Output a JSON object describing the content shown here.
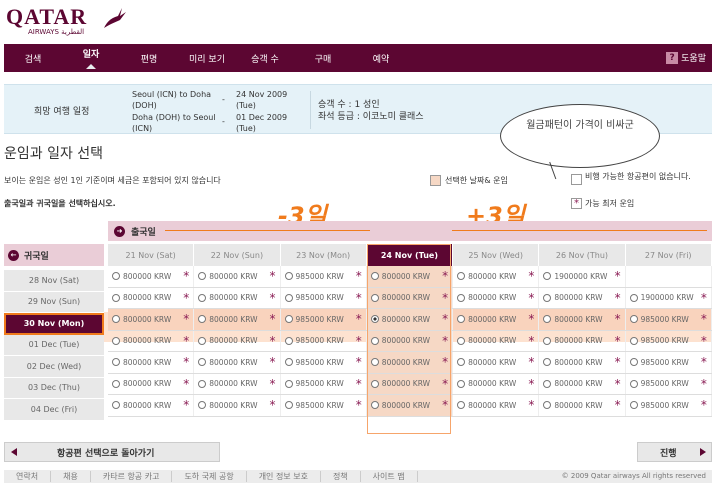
{
  "brand": {
    "name": "QATAR",
    "sub": "AIRWAYS القطرية"
  },
  "nav": {
    "items": [
      "검색",
      "일자",
      "편명",
      "미리 보기",
      "승객 수",
      "구매",
      "예약"
    ],
    "help": "도움말"
  },
  "summary": {
    "title": "희망 여행 일정",
    "out_route": "Seoul (ICN) to Doha (DOH)",
    "out_date": "24 Nov 2009 (Tue)",
    "ret_route": "Doha (DOH) to Seoul (ICN)",
    "ret_date": "01 Dec 2009 (Tue)",
    "pax": "승객 수 : 1 성인",
    "cabin": "좌석 등급 : 이코노미 클래스"
  },
  "section_title": "운임과 일자 선택",
  "note": "보이는 운임은 성인 1인 기준이며 세금은 포함되어 있지 않습니다",
  "instruction": "출국일과 귀국일을 선택하십시오.",
  "legend": {
    "selected": "선택한 날짜& 운임",
    "unavailable": "비행 가능한 항공편이 없습니다.",
    "lowest": "가능 최저 운임"
  },
  "annotation": {
    "bubble": "월금패턴이 가격이 비싸군",
    "minus": "-3일",
    "plus": "+3일"
  },
  "departure_label": "출국일",
  "return_label": "귀국일",
  "columns": [
    "21 Nov (Sat)",
    "22 Nov (Sun)",
    "23 Nov (Mon)",
    "24 Nov (Tue)",
    "25 Nov (Wed)",
    "26 Nov (Thu)",
    "27 Nov (Fri)"
  ],
  "rows": [
    {
      "label": "28 Nov (Sat)",
      "fares": [
        "800000 KRW",
        "800000 KRW",
        "985000 KRW",
        "800000 KRW",
        "800000 KRW",
        "1900000 KRW",
        ""
      ]
    },
    {
      "label": "29 Nov (Sun)",
      "fares": [
        "800000 KRW",
        "800000 KRW",
        "985000 KRW",
        "800000 KRW",
        "800000 KRW",
        "800000 KRW",
        "1900000 KRW"
      ]
    },
    {
      "label": "30 Nov (Mon)",
      "fares": [
        "800000 KRW",
        "800000 KRW",
        "985000 KRW",
        "800000 KRW",
        "800000 KRW",
        "800000 KRW",
        "985000 KRW"
      ]
    },
    {
      "label": "01 Dec (Tue)",
      "fares": [
        "800000 KRW",
        "800000 KRW",
        "985000 KRW",
        "800000 KRW",
        "800000 KRW",
        "800000 KRW",
        "985000 KRW"
      ]
    },
    {
      "label": "02 Dec (Wed)",
      "fares": [
        "800000 KRW",
        "800000 KRW",
        "985000 KRW",
        "800000 KRW",
        "800000 KRW",
        "800000 KRW",
        "985000 KRW"
      ]
    },
    {
      "label": "03 Dec (Thu)",
      "fares": [
        "800000 KRW",
        "800000 KRW",
        "985000 KRW",
        "800000 KRW",
        "800000 KRW",
        "800000 KRW",
        "985000 KRW"
      ]
    },
    {
      "label": "04 Dec (Fri)",
      "fares": [
        "800000 KRW",
        "800000 KRW",
        "985000 KRW",
        "800000 KRW",
        "800000 KRW",
        "800000 KRW",
        "985000 KRW"
      ]
    }
  ],
  "buttons": {
    "back": "항공편 선택으로 돌아가기",
    "next": "진행"
  },
  "footer": {
    "links": [
      "연락처",
      "채용",
      "카타르 항공 카고",
      "도하 국제 공항",
      "개인 정보 보호",
      "정책",
      "사이트 맵"
    ],
    "copyright": "© 2009 Qatar airways All rights reserved"
  },
  "colors": {
    "brand": "#5c0632",
    "accent": "#f07b1c",
    "selected": "#f6d8c5"
  }
}
